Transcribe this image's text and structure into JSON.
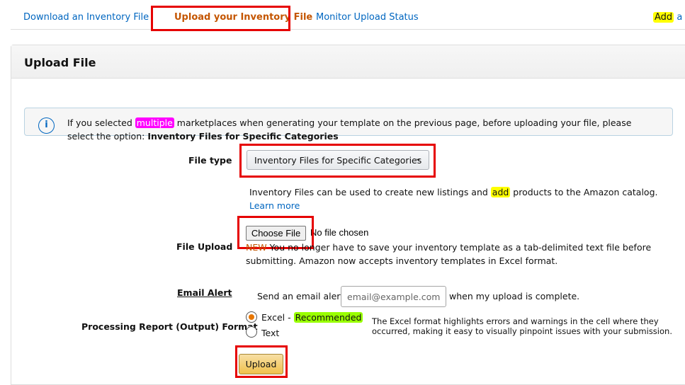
{
  "tabs": [
    {
      "label": "Download an Inventory File",
      "active": false
    },
    {
      "label": "Upload your Inventory File",
      "active": true
    },
    {
      "label": "Monitor Upload Status",
      "active": false
    }
  ],
  "top_right": {
    "add_highlight": "Add",
    "trailing": "a"
  },
  "panel": {
    "title": "Upload File"
  },
  "info": {
    "icon": "info-icon",
    "text_before": "If you selected ",
    "highlight": "multiple",
    "text_after": " marketplaces when generating your template on the previous page, before uploading your file, please select the option:  ",
    "bold_option": "Inventory Files for Specific Categories"
  },
  "file_type": {
    "label": "File type",
    "selected": "Inventory Files for Specific Categories",
    "desc_before": "Inventory Files can be used to create new listings and ",
    "desc_highlight": "add",
    "desc_after": " products to the Amazon catalog.",
    "learn_more": "Learn more"
  },
  "file_upload": {
    "label": "File Upload",
    "button": "Choose File",
    "status": "No file chosen",
    "new_tag": "NEW",
    "note_line1": " You no longer have to save your inventory template as a tab-delimited text file before",
    "note_line2": "submitting. Amazon now accepts inventory templates in Excel format."
  },
  "email_alert": {
    "label": "Email Alert",
    "prefix": "Send an email alert",
    "placeholder": "email@example.com",
    "suffix": "when my upload is complete."
  },
  "report_format": {
    "label": "Processing Report (Output) Format",
    "options": [
      {
        "label": "Excel - ",
        "badge": "Recommended",
        "checked": true
      },
      {
        "label": "Text",
        "checked": false
      }
    ],
    "desc_line1": "The Excel format highlights errors and warnings in the cell where they",
    "desc_line2": "occurred, making it easy to visually pinpoint issues with your submission."
  },
  "upload_button": "Upload",
  "colors": {
    "link": "#0066c0",
    "active_tab": "#c45500",
    "annotation_box": "#e60000",
    "radio_checked": "#e77600"
  }
}
